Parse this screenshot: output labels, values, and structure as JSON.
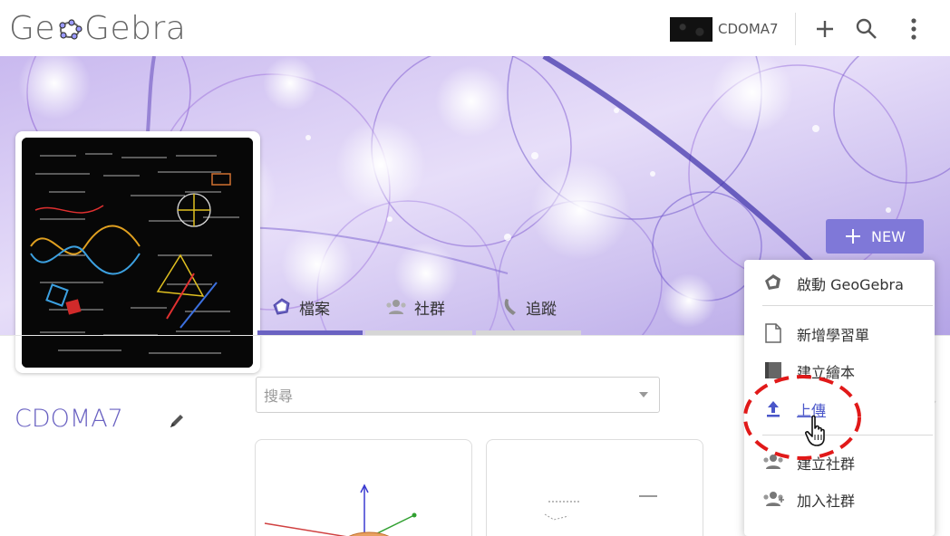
{
  "header": {
    "logo_left": "Ge",
    "logo_right": "Gebra",
    "user_name": "CDOMA7",
    "icons": [
      "plus-icon",
      "search-icon",
      "more-vertical-icon"
    ]
  },
  "profile": {
    "username": "CDOMA7"
  },
  "tabs": [
    {
      "label": "檔案",
      "icon": "geogebra-logo-icon",
      "active": true
    },
    {
      "label": "社群",
      "icon": "groups-icon",
      "active": false
    },
    {
      "label": "追蹤",
      "icon": "follow-icon",
      "active": false
    }
  ],
  "search": {
    "placeholder": "搜尋"
  },
  "new_button": {
    "label": "NEW"
  },
  "menu": {
    "items": [
      {
        "label": "啟動 GeoGebra",
        "icon": "geogebra-logo-icon"
      },
      {
        "label": "新增學習單",
        "icon": "document-icon"
      },
      {
        "label": "建立繪本",
        "icon": "book-icon"
      },
      {
        "label": "上傳",
        "icon": "upload-icon"
      },
      {
        "label": "建立社群",
        "icon": "groups-icon"
      },
      {
        "label": "加入社群",
        "icon": "join-group-icon"
      }
    ]
  },
  "colors": {
    "accent": "#6a62c2",
    "new_button": "#7f78d8",
    "tab_active": "#6a62c2",
    "tab_inactive": "#d6d6d6",
    "annotation_red": "#e11919",
    "upload_link": "#4a56c9"
  }
}
